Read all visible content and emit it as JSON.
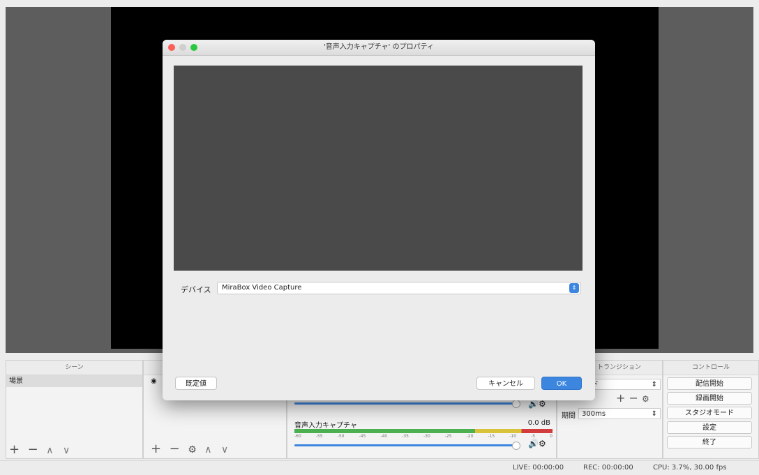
{
  "dialog": {
    "title": "'音声入力キャプチャ' のプロパティ",
    "device_label": "デバイス",
    "device_value": "MiraBox Video Capture",
    "defaults_button": "既定値",
    "cancel_button": "キャンセル",
    "ok_button": "OK"
  },
  "scenes": {
    "title": "シーン",
    "items": [
      "場景"
    ]
  },
  "mixer": {
    "source_name": "音声入力キャプチャ",
    "db_value": "0.0 dB",
    "ticks": [
      "-60",
      "-55",
      "-50",
      "-45",
      "-40",
      "-35",
      "-30",
      "-25",
      "-20",
      "-15",
      "-10",
      "-5",
      "0"
    ]
  },
  "transitions": {
    "title": "トランジション",
    "selected_suffix": "ド",
    "duration_label": "期間",
    "duration_value": "300ms"
  },
  "controls": {
    "title": "コントロール",
    "start_streaming": "配信開始",
    "start_recording": "録画開始",
    "studio_mode": "スタジオモード",
    "settings": "設定",
    "exit": "終了"
  },
  "status": {
    "live": "LIVE: 00:00:00",
    "rec": "REC: 00:00:00",
    "cpu": "CPU: 3.7%, 30.00 fps"
  },
  "colors": {
    "accent": "#3d86e0",
    "close": "#fc5f57",
    "zoom": "#2ac840"
  }
}
